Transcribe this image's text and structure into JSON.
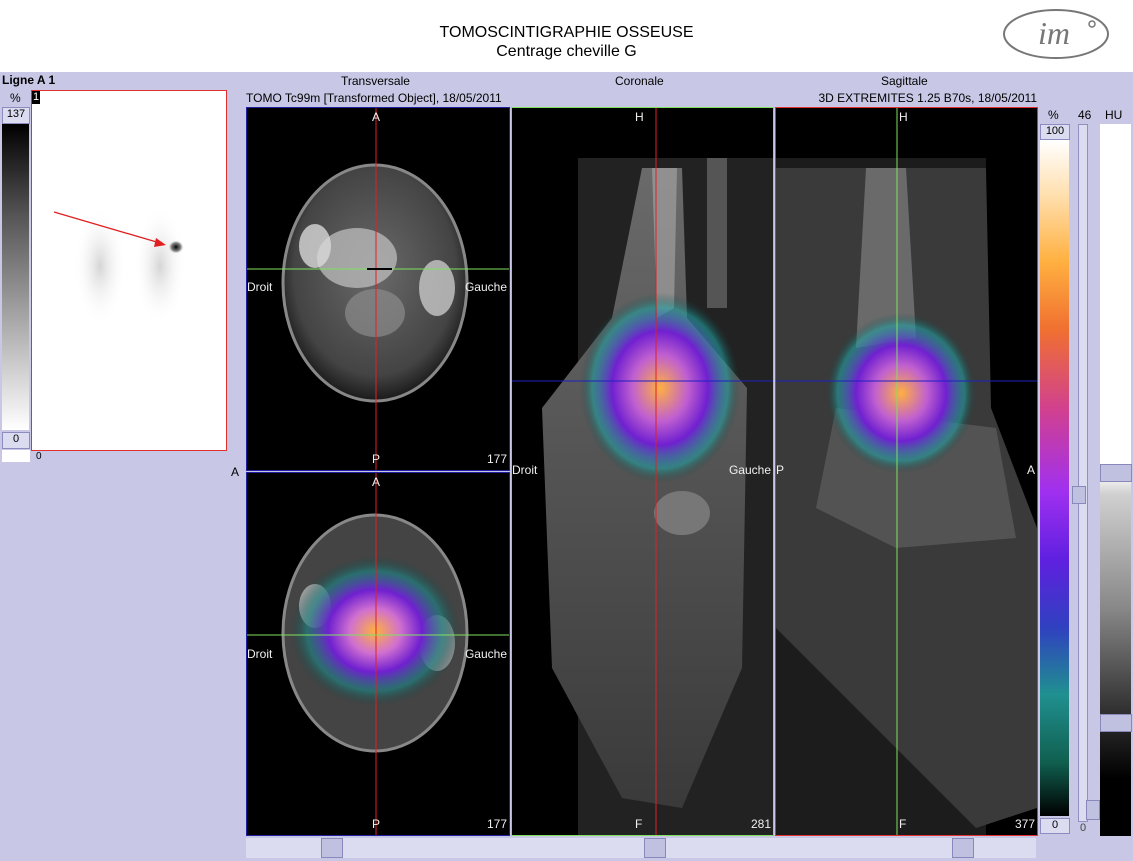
{
  "header": {
    "title": "TOMOSCINTIGRAPHIE OSSEUSE",
    "subtitle": "Centrage cheville G",
    "logo_text": "im"
  },
  "left_panel": {
    "title": "Ligne A 1",
    "unit": "%",
    "max": "137",
    "min": "0",
    "image_index": "1",
    "bottom_index": "0",
    "edge_label": "A"
  },
  "views": {
    "transversal": "Transversale",
    "coronal": "Coronale",
    "sagittal": "Sagittale",
    "series_left": "TOMO Tc99m [Transformed Object], 18/05/2011",
    "series_right": "3D EXTREMITES  1.25  B70s, 18/05/2011"
  },
  "panel_top": {
    "top": "A",
    "bottom": "P",
    "left": "Droit",
    "right": "Gauche",
    "slice": "177"
  },
  "panel_bottom": {
    "top": "A",
    "bottom": "P",
    "left": "Droit",
    "right": "Gauche",
    "slice": "177"
  },
  "panel_coronal": {
    "top": "H",
    "bottom": "F",
    "left": "Droit",
    "right": "Gauche",
    "slice": "281"
  },
  "panel_sagittal": {
    "top": "H",
    "bottom": "F",
    "left": "P",
    "right": "A",
    "slice": "377"
  },
  "right_scales": {
    "pct_label": "%",
    "pct_max": "100",
    "pct_min": "0",
    "slider_value": "46",
    "slider_min": "0",
    "hu_label": "HU"
  },
  "colors": {
    "crosshair_red": "#e02020",
    "crosshair_green": "#80e060",
    "crosshair_blue": "#2020c0",
    "bg": "#c8c8e6"
  }
}
